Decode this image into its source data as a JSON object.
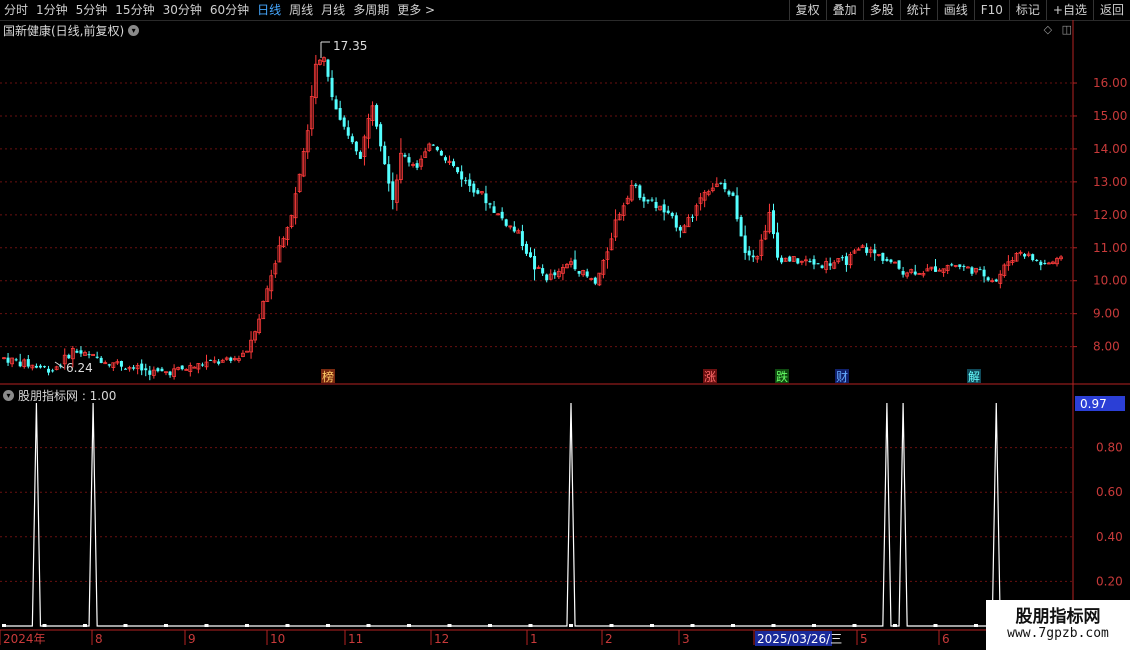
{
  "toolbar": {
    "left_items": [
      "分时",
      "1分钟",
      "5分钟",
      "15分钟",
      "30分钟",
      "60分钟",
      "日线",
      "周线",
      "月线",
      "多周期",
      "更多 >"
    ],
    "active_item": "日线",
    "right_buttons": [
      "复权",
      "叠加",
      "多股",
      "统计",
      "画线",
      "F10",
      "标记",
      "+自选",
      "返回"
    ]
  },
  "main_chart": {
    "title": "国新健康(日线,前复权)",
    "price_axis_labels": [
      "16.00",
      "15.00",
      "14.00",
      "13.00",
      "12.00",
      "11.00",
      "10.00",
      "9.00",
      "8.00"
    ],
    "high_label": "17.35",
    "low_label": "6.24",
    "event_markers": [
      "榜",
      "涨",
      "跌",
      "财",
      "解"
    ],
    "colors": {
      "up": "#ff3b3b",
      "down": "#54ffff",
      "marker_bg": "#8a1f1f"
    }
  },
  "indicator": {
    "title": "股朋指标网 : 1.00",
    "current_value": "0.97",
    "axis_labels": [
      "0.80",
      "0.60",
      "0.40",
      "0.20"
    ]
  },
  "date_axis": {
    "labels": [
      "2024年",
      "8",
      "9",
      "10",
      "11",
      "12",
      "1",
      "2",
      "3",
      "2025/03/26/三",
      "5",
      "6"
    ]
  },
  "watermark": {
    "line1": "股朋指标网",
    "line2": "www.7gpzb.com"
  },
  "chart_data": {
    "type": "candlestick",
    "price_ylim": [
      6.24,
      17.35
    ],
    "indicator_ylim": [
      0,
      1.0
    ],
    "indicator_spikes_x_index": [
      8,
      22,
      140,
      218,
      222,
      245
    ]
  }
}
